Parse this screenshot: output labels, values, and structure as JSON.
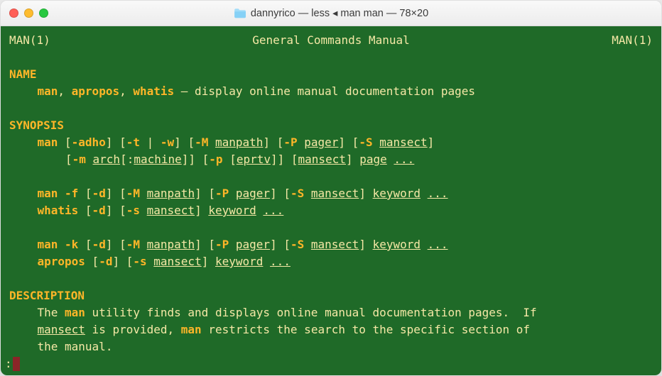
{
  "window": {
    "title": "dannyrico — less ◂ man man — 78×20"
  },
  "header": {
    "left": "MAN(1)",
    "center": "General Commands Manual",
    "right": "MAN(1)"
  },
  "section_name": {
    "heading": "NAME",
    "cmd1": "man",
    "sep1": ", ",
    "cmd2": "apropos",
    "sep2": ", ",
    "cmd3": "whatis",
    "desc": " — display online manual documentation pages"
  },
  "section_synopsis": {
    "heading": "SYNOPSIS",
    "l1_cmd": "man",
    "l1_o1": " [",
    "l1_f1": "-adho",
    "l1_o2": "] [",
    "l1_f2": "-t",
    "l1_o3": " | ",
    "l1_f3": "-w",
    "l1_o4": "] [",
    "l1_f4": "-M",
    "l1_o5": " ",
    "l1_a1": "manpath",
    "l1_o6": "] [",
    "l1_f5": "-P",
    "l1_o7": " ",
    "l1_a2": "pager",
    "l1_o8": "] [",
    "l1_f6": "-S",
    "l1_o9": " ",
    "l1_a3": "mansect",
    "l1_o10": "]",
    "l2_o1": "[",
    "l2_f1": "-m",
    "l2_o2": " ",
    "l2_a1": "arch",
    "l2_o3": "[:",
    "l2_a2": "machine",
    "l2_o4": "]] [",
    "l2_f2": "-p",
    "l2_o5": " [",
    "l2_a3": "eprtv",
    "l2_o6": "]] [",
    "l2_a4": "mansect",
    "l2_o7": "] ",
    "l2_a5": "page",
    "l2_o8": " ",
    "l2_a6": "...",
    "l3_cmd": "man",
    "l3_o1": " ",
    "l3_f1": "-f",
    "l3_o2": " [",
    "l3_f2": "-d",
    "l3_o3": "] [",
    "l3_f3": "-M",
    "l3_o4": " ",
    "l3_a1": "manpath",
    "l3_o5": "] [",
    "l3_f4": "-P",
    "l3_o6": " ",
    "l3_a2": "pager",
    "l3_o7": "] [",
    "l3_f5": "-S",
    "l3_o8": " ",
    "l3_a3": "mansect",
    "l3_o9": "] ",
    "l3_a4": "keyword",
    "l3_o10": " ",
    "l3_a5": "...",
    "l4_cmd": "whatis",
    "l4_o1": " [",
    "l4_f1": "-d",
    "l4_o2": "] [",
    "l4_f2": "-s",
    "l4_o3": " ",
    "l4_a1": "mansect",
    "l4_o4": "] ",
    "l4_a2": "keyword",
    "l4_o5": " ",
    "l4_a3": "...",
    "l5_cmd": "man",
    "l5_o1": " ",
    "l5_f1": "-k",
    "l5_o2": " [",
    "l5_f2": "-d",
    "l5_o3": "] [",
    "l5_f3": "-M",
    "l5_o4": " ",
    "l5_a1": "manpath",
    "l5_o5": "] [",
    "l5_f4": "-P",
    "l5_o6": " ",
    "l5_a2": "pager",
    "l5_o7": "] [",
    "l5_f5": "-S",
    "l5_o8": " ",
    "l5_a3": "mansect",
    "l5_o9": "] ",
    "l5_a4": "keyword",
    "l5_o10": " ",
    "l5_a5": "...",
    "l6_cmd": "apropos",
    "l6_o1": " [",
    "l6_f1": "-d",
    "l6_o2": "] [",
    "l6_f2": "-s",
    "l6_o3": " ",
    "l6_a1": "mansect",
    "l6_o4": "] ",
    "l6_a2": "keyword",
    "l6_o5": " ",
    "l6_a3": "..."
  },
  "section_desc": {
    "heading": "DESCRIPTION",
    "p1a": "The ",
    "p1b": "man",
    "p1c": " utility finds and displays online manual documentation pages.  If",
    "p2a": "mansect",
    "p2b": " is provided, ",
    "p2c": "man",
    "p2d": " restricts the search to the specific section of",
    "p3a": "the manual."
  },
  "prompt": ":"
}
